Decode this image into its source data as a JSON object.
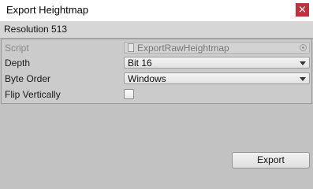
{
  "window": {
    "title": "Export Heightmap",
    "close_label": "×"
  },
  "header": {
    "text": "Resolution 513"
  },
  "properties": {
    "script": {
      "label": "Script",
      "value": "ExportRawHeightmap"
    },
    "depth": {
      "label": "Depth",
      "value": "Bit 16"
    },
    "byte_order": {
      "label": "Byte Order",
      "value": "Windows"
    },
    "flip_vertically": {
      "label": "Flip Vertically",
      "checked": false
    }
  },
  "actions": {
    "export_label": "Export"
  }
}
